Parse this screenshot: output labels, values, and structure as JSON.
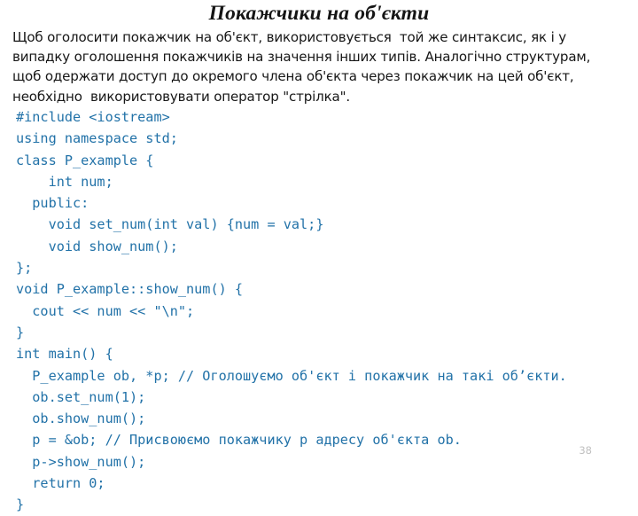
{
  "slide": {
    "title": "Покажчики на об'єкти",
    "page_number": "38",
    "title_color": "#151515",
    "body_color": "#171717",
    "code_color": "#2272a8",
    "page_number_color": "#c0c0c0",
    "background_color": "#ffffff"
  },
  "body": {
    "lines": [
      "Щоб оголосити покажчик на об'єкт, використовується  той же синтаксис, як і у",
      "випадку оголошення покажчиків на значення інших типів. Аналогічно структурам,",
      "щоб одержати доступ до окремого члена об'єкта через покажчик на цей об'єкт,",
      "необхідно  використовувати оператор \"стрілка\"."
    ]
  },
  "code": {
    "language": "cpp",
    "lines": [
      "#include <iostream>",
      "using namespace std;",
      "class P_example {",
      "    int num;",
      "  public:",
      "    void set_num(int val) {num = val;}",
      "    void show_num();",
      "};",
      "void P_example::show_num() {",
      "  cout << num << \"\\n\";",
      "}",
      "int main() {",
      "  P_example ob, *p; // Оголошуємо об'єкт і покажчик на такі об’єкти.",
      "  ob.set_num(1);",
      "  ob.show_num();",
      "  p = &ob; // Присвоюємо покажчику p адресу об'єкта ob.",
      "  p->show_num();",
      "  return 0;",
      "}"
    ]
  }
}
